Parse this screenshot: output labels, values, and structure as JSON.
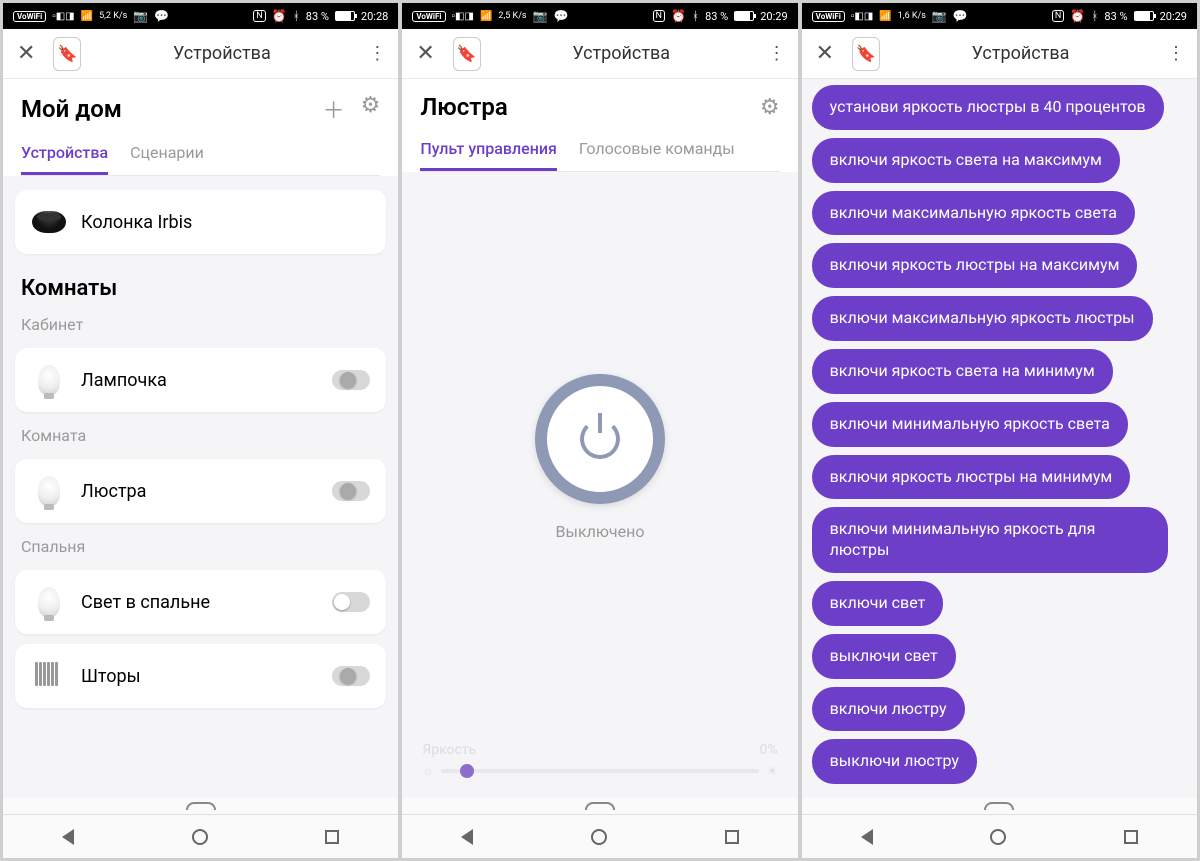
{
  "screens": [
    {
      "status": {
        "vowifi": "VoWiFi",
        "speed": "5,2",
        "speed_unit": "K/s",
        "nfc": "N",
        "battery": "83 %",
        "time": "20:28"
      },
      "browser_title": "Устройства",
      "page_title": "Мой дом",
      "tabs": [
        "Устройства",
        "Сценарии"
      ],
      "top_device": "Колонка Irbis",
      "rooms_header": "Комнаты",
      "rooms": [
        {
          "name": "Кабинет",
          "devices": [
            {
              "label": "Лампочка",
              "icon": "bulb"
            }
          ]
        },
        {
          "name": "Комната",
          "devices": [
            {
              "label": "Люстра",
              "icon": "bulb"
            }
          ]
        },
        {
          "name": "Спальня",
          "devices": [
            {
              "label": "Свет в спальне",
              "icon": "bulb"
            },
            {
              "label": "Шторы",
              "icon": "curtain"
            }
          ]
        }
      ]
    },
    {
      "status": {
        "vowifi": "VoWiFi",
        "speed": "2,5",
        "speed_unit": "K/s",
        "nfc": "N",
        "battery": "83 %",
        "time": "20:29"
      },
      "browser_title": "Устройства",
      "page_title": "Люстра",
      "tabs": [
        "Пульт управления",
        "Голосовые команды"
      ],
      "power_status": "Выключено",
      "brightness_label": "Яркость",
      "brightness_value": "0%"
    },
    {
      "status": {
        "vowifi": "VoWiFi",
        "speed": "1,6",
        "speed_unit": "K/s",
        "nfc": "N",
        "battery": "83 %",
        "time": "20:29"
      },
      "browser_title": "Устройства",
      "commands": [
        "установи яркость люстры в 40 процентов",
        "включи яркость света на максимум",
        "включи максимальную яркость света",
        "включи яркость люстры на максимум",
        "включи максимальную яркость люстры",
        "включи яркость света на минимум",
        "включи минимальную яркость света",
        "включи яркость люстры на минимум",
        "включи минимальную яркость для люстры",
        "включи свет",
        "выключи свет",
        "включи люстру",
        "выключи люстру"
      ]
    }
  ]
}
